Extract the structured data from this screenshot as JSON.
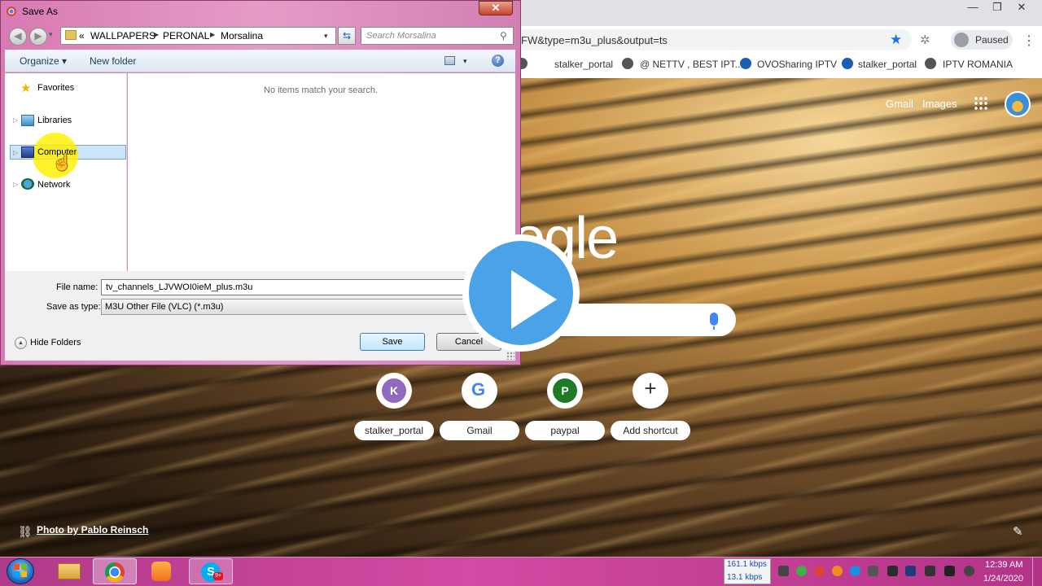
{
  "browser": {
    "omnibox_text": "FW&type=m3u_plus&output=ts",
    "profile_label": "Paused",
    "bookmarks": [
      "stalker_portal",
      "@ NETTV , BEST IPT...",
      "OVOSharing IPTV",
      "stalker_portal",
      "IPTV ROMANIA"
    ],
    "gmail_link": "Gmail",
    "images_link": "Images",
    "logo_fragment": "ogle",
    "shortcuts": [
      {
        "label": "stalker_portal",
        "letter": "K",
        "color": "#8e6bbf"
      },
      {
        "label": "Gmail",
        "letter": "G",
        "color": "#4285f4"
      },
      {
        "label": "paypal",
        "letter": "P",
        "color": "#1e7a24"
      },
      {
        "label": "Add shortcut",
        "letter": "+",
        "color": "#333333"
      }
    ],
    "photo_credit": "Photo by Pablo Reinsch"
  },
  "dialog": {
    "title": "Save As",
    "close_glyph": "✕",
    "breadcrumb_prefix": "«",
    "breadcrumb": [
      "WALLPAPERS",
      "PERONAL",
      "Morsalina"
    ],
    "search_placeholder": "Search Morsalina",
    "toolbar": {
      "organize": "Organize ▾",
      "new_folder": "New folder",
      "help": "?"
    },
    "nav_tree": [
      "Favorites",
      "Libraries",
      "Computer",
      "Network"
    ],
    "empty_message": "No items match your search.",
    "file_name_label": "File name:",
    "file_name_value": "tv_channels_LJVWOI0ieM_plus.m3u",
    "save_type_label": "Save as type:",
    "save_type_value": "M3U Other File (VLC) (*.m3u)",
    "hide_folders": "Hide Folders",
    "save_button": "Save",
    "cancel_button": "Cancel"
  },
  "taskbar": {
    "skype_letter": "S",
    "skype_badge": "9+",
    "speed_down": "161.1 kbps",
    "speed_up": "13.1 kbps",
    "time": "12:39 AM",
    "date": "1/24/2020"
  },
  "colors": {
    "dialog_frame": "#d87ab3",
    "taskbar": "#c0409a",
    "play_button": "#4aa3e8",
    "chrome_accent": "#1a73e8"
  }
}
